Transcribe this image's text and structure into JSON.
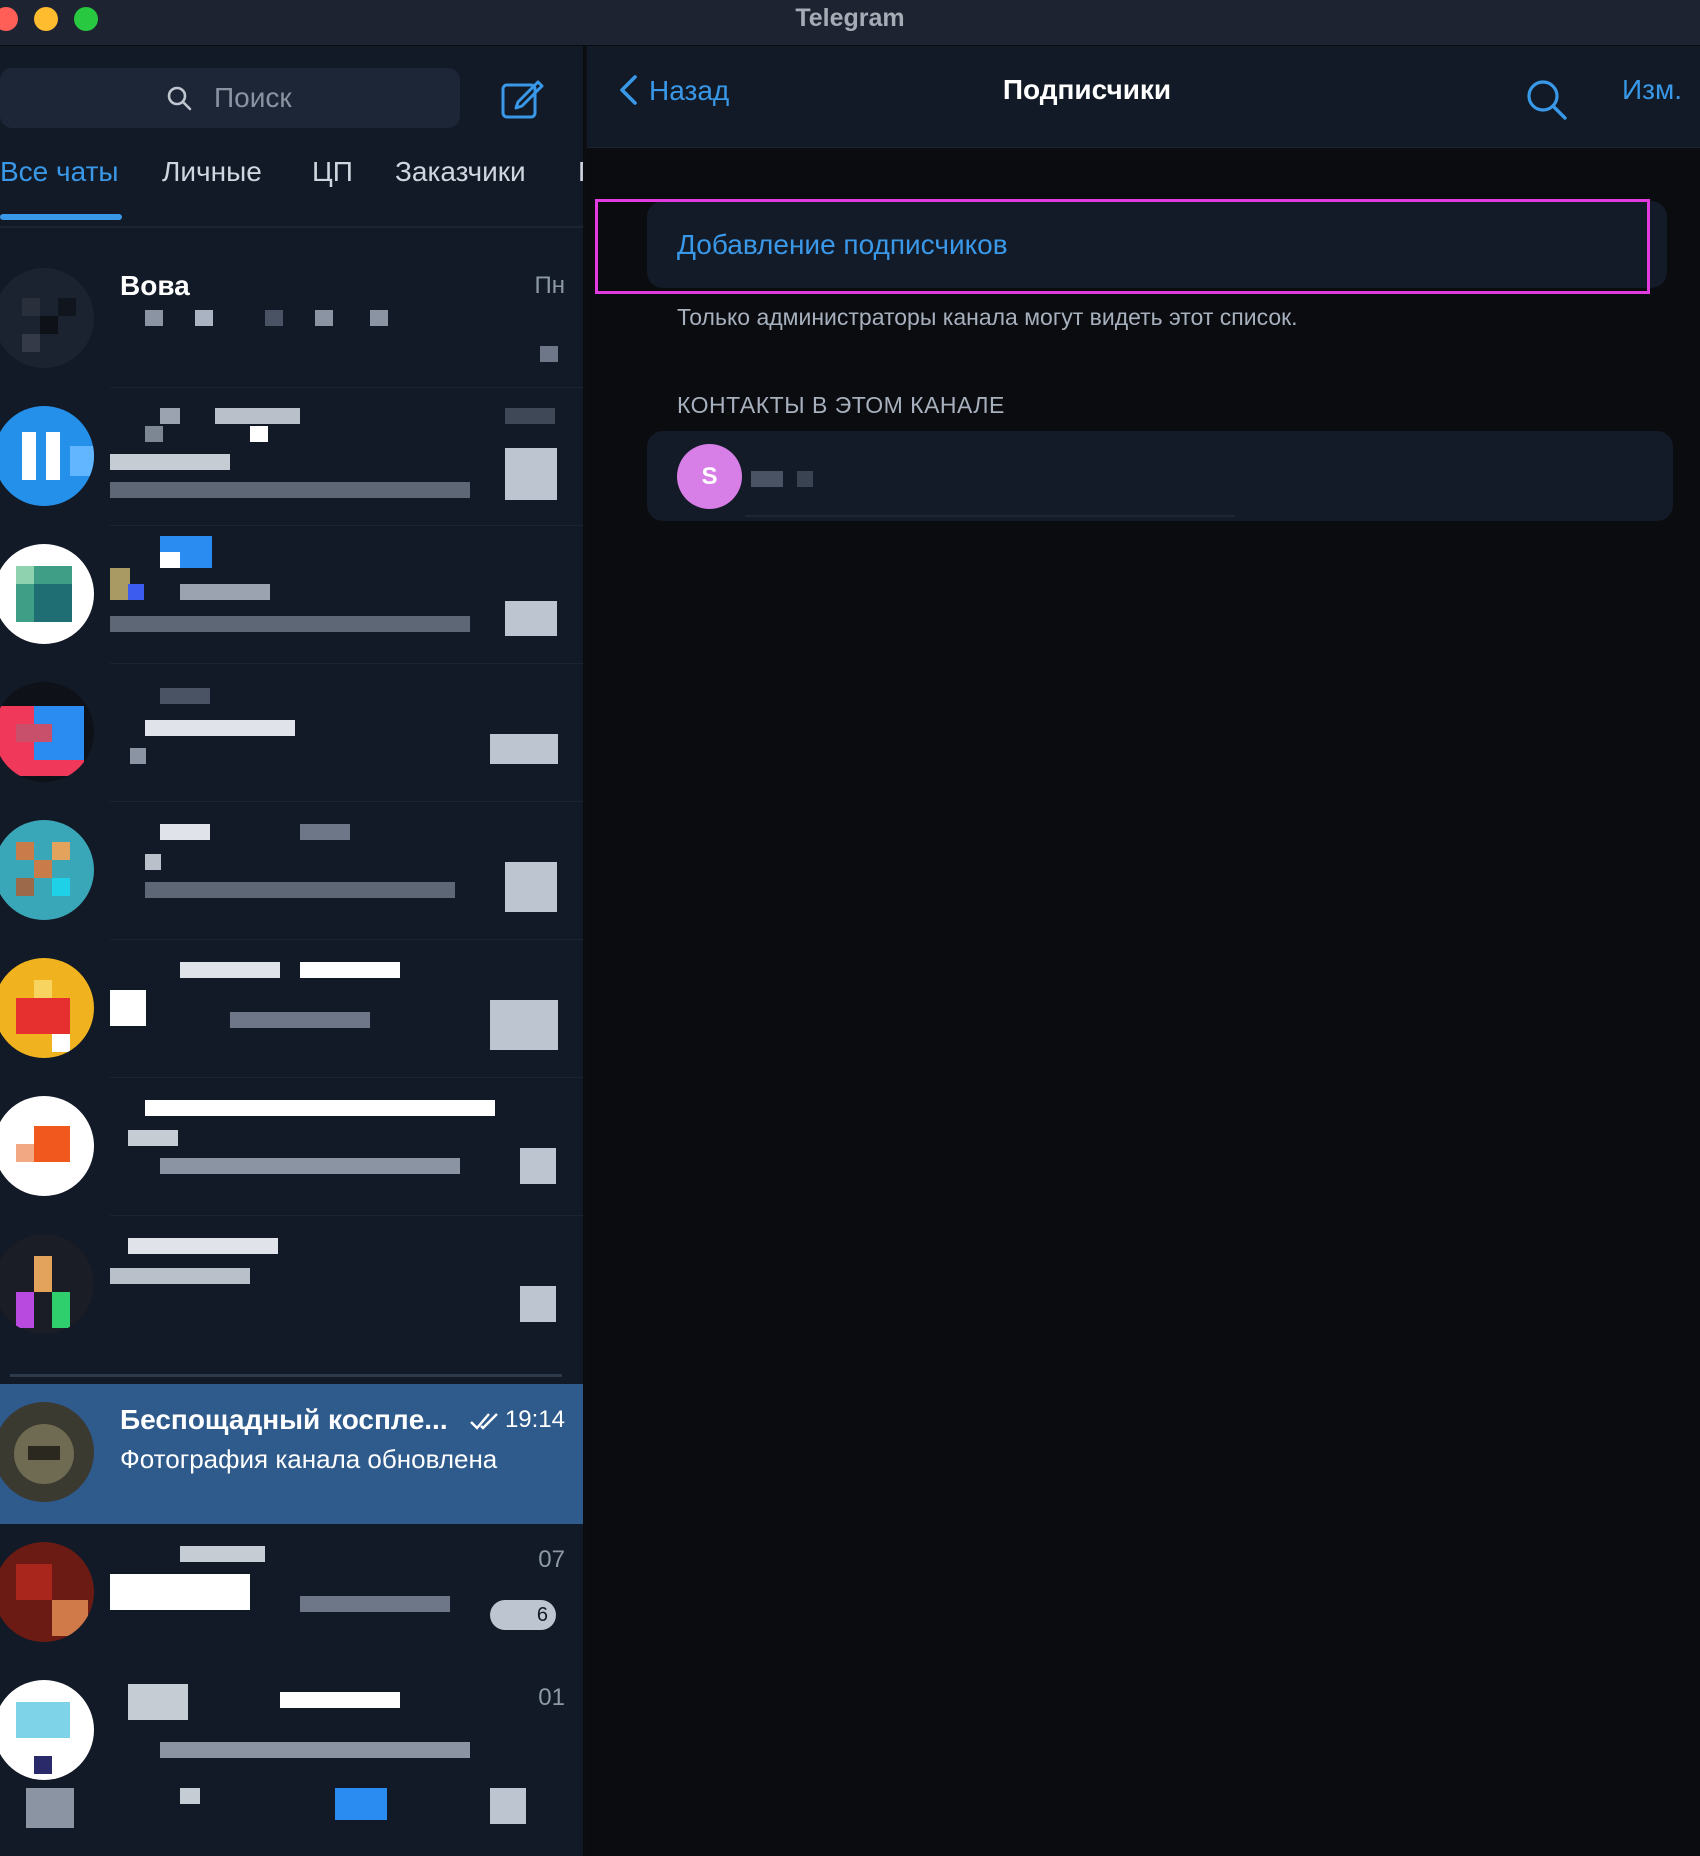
{
  "window": {
    "title": "Telegram"
  },
  "sidebar": {
    "search_placeholder": "Поиск",
    "tabs": [
      "Все чаты",
      "Личные",
      "ЦП",
      "Заказчики",
      "Г"
    ],
    "chats": [
      {
        "name": "Вова",
        "time": "Пн"
      },
      {
        "name": "Беспощадный косплe...",
        "time": "19:14",
        "preview": "Фотография канала обновлена",
        "read": true,
        "selected": true
      }
    ],
    "partial_times": [
      "07",
      "01"
    ],
    "partial_badge": "6"
  },
  "header": {
    "back_label": "Назад",
    "title": "Подписчики",
    "edit_label": "Изм."
  },
  "content": {
    "add_subscribers_label": "Добавление подписчиков",
    "admin_note": "Только администраторы канала могут видеть этот список.",
    "section_title": "КОНТАКТЫ В ЭТОМ КАНАЛЕ",
    "contact_initial": "S"
  },
  "colors": {
    "accent": "#3a98e8",
    "selected_chat": "#2f5a8c",
    "highlight_border": "#e23ce0",
    "contact_avatar": "#d77fe6"
  }
}
